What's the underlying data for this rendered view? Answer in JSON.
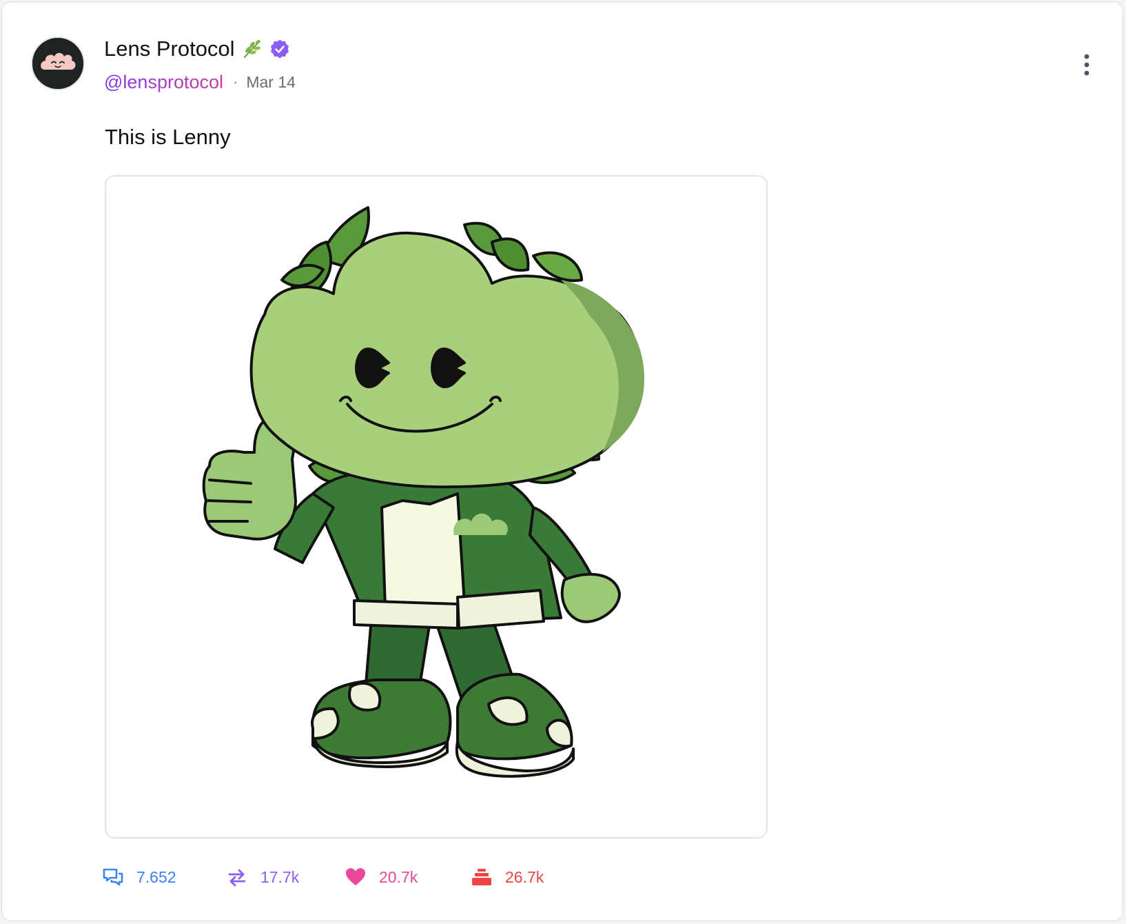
{
  "post": {
    "author": {
      "display_name": "Lens Protocol",
      "name_emoji": "herb-icon",
      "verified_icon": "verified-badge-icon",
      "handle": "@lensprotocol"
    },
    "separator": "·",
    "date": "Mar 14",
    "text": "This is Lenny",
    "media": {
      "alt": "Lenny mascot giving a thumbs up"
    },
    "menu_icon": "more-vertical-icon"
  },
  "actions": [
    {
      "name": "comment",
      "icon": "comment-icon",
      "count": "7.652",
      "color": "#3b82f6"
    },
    {
      "name": "mirror",
      "icon": "mirror-icon",
      "count": "17.7k",
      "color": "#8b5cf6"
    },
    {
      "name": "like",
      "icon": "heart-icon",
      "count": "20.7k",
      "color": "#ec4899"
    },
    {
      "name": "collect",
      "icon": "collect-icon",
      "count": "26.7k",
      "color": "#ef4444"
    }
  ],
  "colors": {
    "handle_gradient_start": "#7c3aed",
    "handle_gradient_end": "#c83c9d",
    "verified": "#8b5cf6"
  }
}
